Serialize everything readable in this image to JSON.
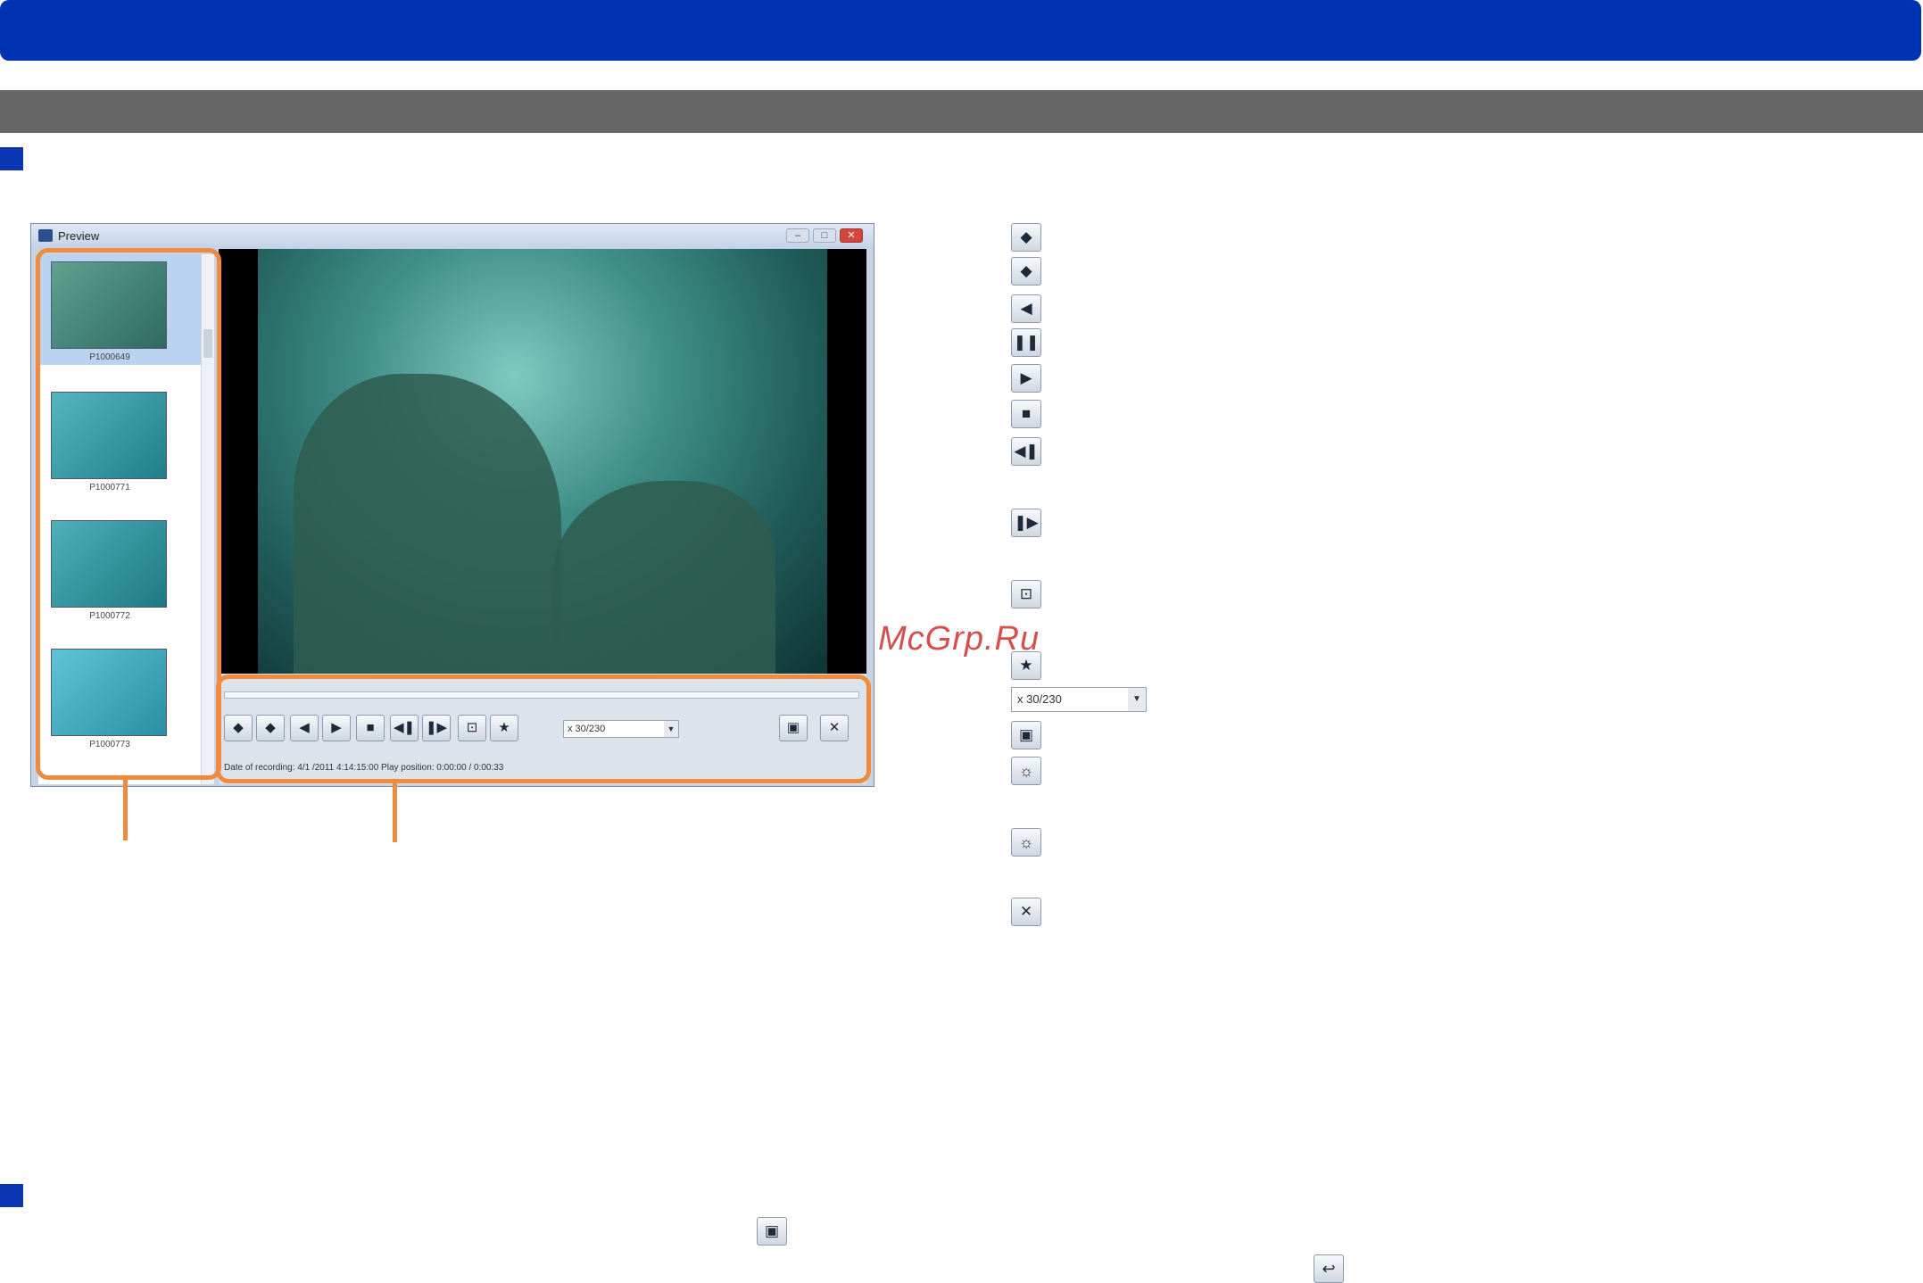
{
  "window": {
    "title": "Preview",
    "controls": [
      "–",
      "□",
      "✕"
    ]
  },
  "thumbnails": [
    {
      "label": "P1000649",
      "selected": true
    },
    {
      "label": "P1000771",
      "selected": false
    },
    {
      "label": "P1000772",
      "selected": false
    },
    {
      "label": "P1000773",
      "selected": false
    }
  ],
  "player": {
    "speed": "x 30/230",
    "status": "Date of recording:  4/1 /2011 4:14:15:00      Play position:    0:00:00  /  0:00:33"
  },
  "buttons": {
    "prev_file": "◆",
    "next_file": "◆",
    "reverse": "◀",
    "play": "▶",
    "pause": "❚❚",
    "stop": "■",
    "frame_back": "◀❚",
    "frame_forward": "❚▶",
    "capture": "⊡",
    "favorite": "★",
    "fullscreen": "▣",
    "close": "✕"
  },
  "watermark": "McGrp.Ru",
  "colors": {
    "title_bar": "#0033b4",
    "section_bar": "#666666",
    "highlight": "#f08a3c"
  }
}
